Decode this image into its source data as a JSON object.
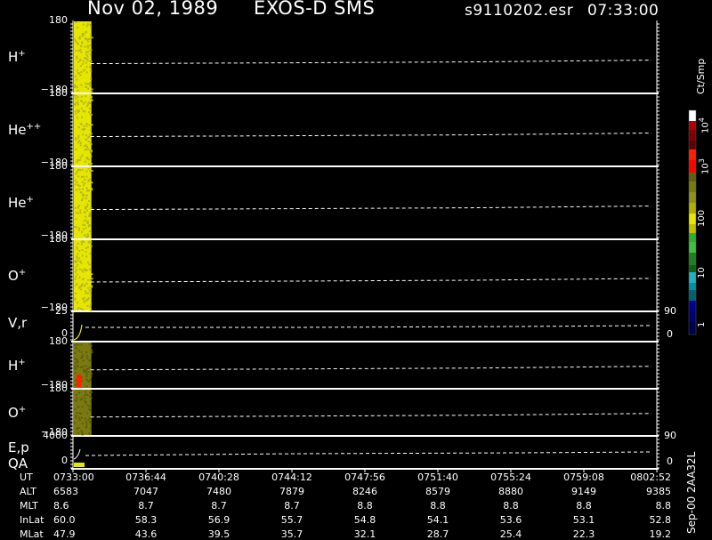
{
  "header": {
    "date": "Nov 02, 1989",
    "instrument": "EXOS-D SMS",
    "file": "s9110202.esr",
    "time": "07:33:00"
  },
  "colorbar": {
    "unit": "Ct/Smp",
    "labels": [
      "10",
      "10",
      "100",
      "10",
      "1"
    ],
    "exponents": [
      "4",
      "3"
    ]
  },
  "plot_id": "Sep-00  2AA32L",
  "panels": [
    {
      "label": "H",
      "charge": "+",
      "top_tick": "180",
      "bottom_tick": "−180"
    },
    {
      "label": "He",
      "charge": "++",
      "top_tick": "180",
      "bottom_tick": "−180"
    },
    {
      "label": "He",
      "charge": "+",
      "top_tick": "180",
      "bottom_tick": "−180"
    },
    {
      "label": "O",
      "charge": "+",
      "top_tick": "180",
      "bottom_tick": "−180"
    },
    {
      "label": "V,r",
      "charge": "",
      "top_tick": "25",
      "bottom_tick": "0",
      "right_top": "90",
      "right_bottom": "0"
    },
    {
      "label": "H",
      "charge": "+",
      "top_tick": "180",
      "bottom_tick": "−180"
    },
    {
      "label": "O",
      "charge": "+",
      "top_tick": "180",
      "bottom_tick": "−180"
    },
    {
      "label": "E,p",
      "label2": "QA",
      "charge": "",
      "top_tick": "4000",
      "bottom_tick": "0",
      "right_top": "90",
      "right_bottom": "0"
    }
  ],
  "table": {
    "row_labels": [
      "UT",
      "ALT",
      "MLT",
      "InLat",
      "MLat"
    ],
    "UT": [
      "0733:00",
      "0736:44",
      "0740:28",
      "0744:12",
      "0747:56",
      "0751:40",
      "0755:24",
      "0759:08",
      "0802:52"
    ],
    "ALT": [
      "6583",
      "7047",
      "7480",
      "7879",
      "8246",
      "8579",
      "8880",
      "9149",
      "9385"
    ],
    "MLT": [
      "8.6",
      "8.7",
      "8.7",
      "8.7",
      "8.8",
      "8.8",
      "8.8",
      "8.8",
      "8.8"
    ],
    "InLat": [
      "60.0",
      "58.3",
      "56.9",
      "55.7",
      "54.8",
      "54.1",
      "53.6",
      "53.1",
      "52.8"
    ],
    "MLat": [
      "47.9",
      "43.6",
      "39.5",
      "35.7",
      "32.1",
      "28.7",
      "25.4",
      "22.3",
      "19.2"
    ]
  },
  "chart_data": {
    "type": "heatmap",
    "title": "Nov 02, 1989   EXOS-D SMS",
    "time_range": [
      "0733:00",
      "0802:52"
    ],
    "x_ticks": [
      "0733:00",
      "0736:44",
      "0740:28",
      "0744:12",
      "0747:56",
      "0751:40",
      "0755:24",
      "0759:08",
      "0802:52"
    ],
    "colorbar_scale": "log",
    "colorbar_range": [
      1,
      10000
    ],
    "data_coverage_fraction": 0.03,
    "pitch_angle_panels": [
      "H+",
      "He++",
      "He+",
      "O+",
      "H+",
      "O+"
    ],
    "reference_line_trend": "slowly rising dashed line across each angle panel",
    "colors": {
      "high": "#ffffff",
      "dark_red": "#8b0000",
      "red": "#ff2000",
      "olive": "#7a7a10",
      "yellow": "#e6e600",
      "green": "#30b030",
      "cyan": "#20b0c0",
      "blue": "#000080"
    }
  }
}
